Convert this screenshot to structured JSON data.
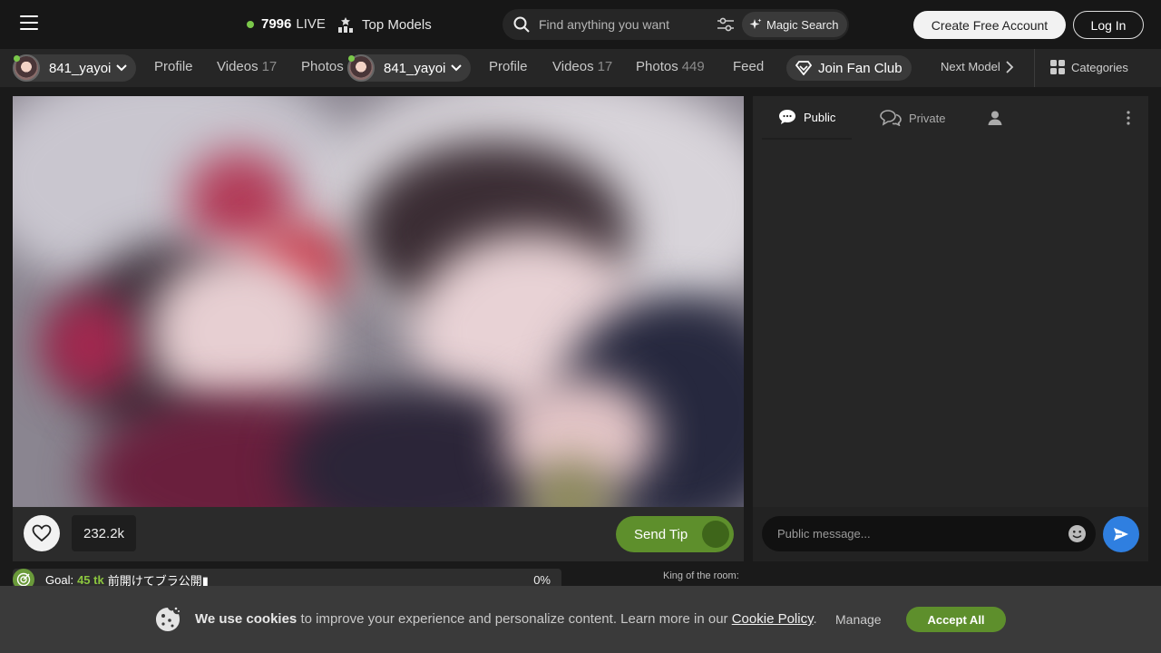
{
  "header": {
    "live_count": "7996",
    "live_label": "LIVE",
    "top_models": "Top Models",
    "search_placeholder": "Find anything you want",
    "magic_search": "Magic Search",
    "create_account": "Create Free Account",
    "login": "Log In"
  },
  "subnav": {
    "username": "841_yayoi",
    "profile": "Profile",
    "videos": "Videos",
    "videos_count": "17",
    "photos": "Photos",
    "photos_count": "449",
    "feed": "Feed",
    "join_fan_club": "Join Fan Club",
    "next_model": "Next Model",
    "categories": "Categories"
  },
  "player": {
    "likes": "232.2k",
    "send_tip": "Send Tip"
  },
  "goal": {
    "label": "Goal:",
    "tokens": "45 tk",
    "text": "前開けてブラ公開▮",
    "percent": "0%"
  },
  "king": {
    "label": "King of the room:"
  },
  "chat": {
    "tab_public": "Public",
    "tab_private": "Private",
    "message_placeholder": "Public message..."
  },
  "cookie": {
    "bold": "We use cookies",
    "text": " to improve your experience and personalize content. Learn more in our ",
    "policy_link": "Cookie Policy",
    "period": ".",
    "manage": "Manage",
    "accept": "Accept All"
  },
  "colors": {
    "accent_green": "#5e8f2c",
    "online_green": "#7bc84a",
    "send_blue": "#2f7fe0"
  }
}
